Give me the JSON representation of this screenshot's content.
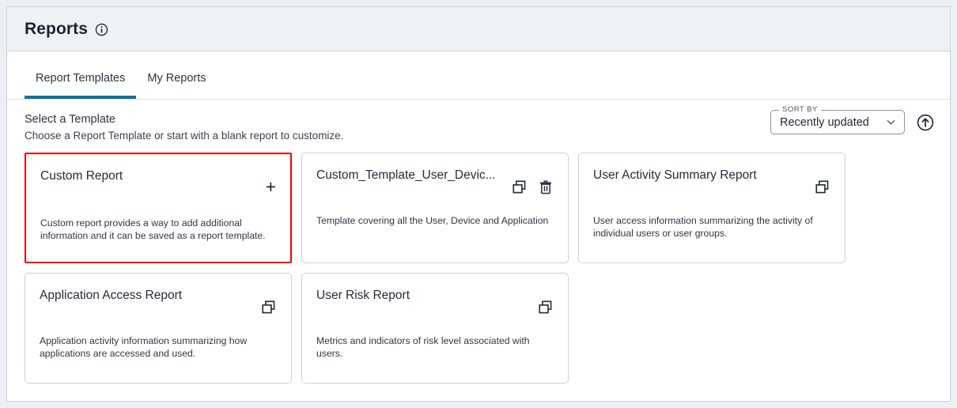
{
  "header": {
    "title": "Reports",
    "info_icon": "info-circle-icon"
  },
  "tabs": [
    {
      "label": "Report Templates",
      "active": true
    },
    {
      "label": "My Reports",
      "active": false
    }
  ],
  "section": {
    "title": "Select a Template",
    "subtitle": "Choose a Report Template or start with a blank report to customize."
  },
  "sort": {
    "legend": "SORT BY",
    "value": "Recently updated",
    "options": [
      "Recently updated"
    ],
    "chevron_icon": "chevron-down-icon",
    "direction_icon": "arrow-up-circle-icon"
  },
  "colors": {
    "accent_tab": "#0a71a3",
    "selected_border": "#ee0000",
    "page_background": "#eceff3",
    "panel_background": "#ffffff",
    "text_primary": "#242c38"
  },
  "cards": [
    {
      "title": "Custom Report",
      "description": "Custom report provides a way to add additional information and it can be saved as a report template.",
      "selected": true,
      "actions": [
        "plus-icon"
      ]
    },
    {
      "title": "Custom_Template_User_Devic...",
      "description": "Template covering all the User, Device and Application",
      "selected": false,
      "actions": [
        "copy-icon",
        "trash-icon"
      ]
    },
    {
      "title": "User Activity Summary Report",
      "description": "User access information summarizing the activity of individual users or user groups.",
      "selected": false,
      "actions": [
        "copy-icon"
      ]
    },
    {
      "title": "Application Access Report",
      "description": "Application activity information summarizing how applications are accessed and used.",
      "selected": false,
      "actions": [
        "copy-icon"
      ]
    },
    {
      "title": "User Risk Report",
      "description": "Metrics and indicators of risk level associated with users.",
      "selected": false,
      "actions": [
        "copy-icon"
      ]
    }
  ]
}
